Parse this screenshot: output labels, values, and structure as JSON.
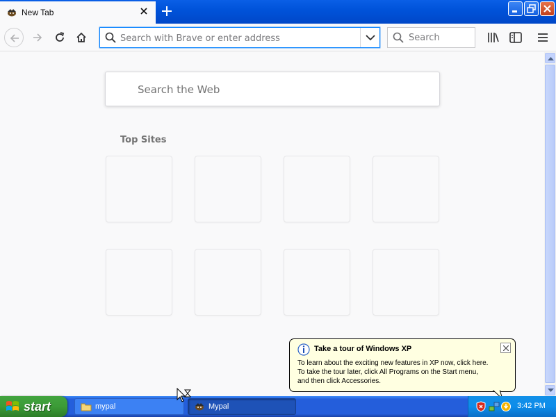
{
  "tab": {
    "title": "New Tab"
  },
  "urlbar": {
    "placeholder": "Search with Brave or enter address"
  },
  "searchbar": {
    "placeholder": "Search"
  },
  "newtab_page": {
    "search_placeholder": "Search the Web",
    "top_sites_title": "Top Sites",
    "top_sites_count": 8
  },
  "balloon": {
    "title": "Take a tour of Windows XP",
    "lines": [
      "To learn about the exciting new features in XP now, click here.",
      "To take the tour later, click All Programs on the Start menu,",
      "and then click Accessories."
    ]
  },
  "taskbar": {
    "start_label": "start",
    "tasks": [
      {
        "label": "mypal",
        "icon": "folder-icon"
      },
      {
        "label": "Mypal",
        "icon": "mypal-icon"
      }
    ],
    "clock": "3:42 PM"
  },
  "colors": {
    "accent": "#0a84ff",
    "xp_blue": "#245edb",
    "xp_green": "#3c9b37",
    "balloon_bg": "#ffffe1"
  }
}
